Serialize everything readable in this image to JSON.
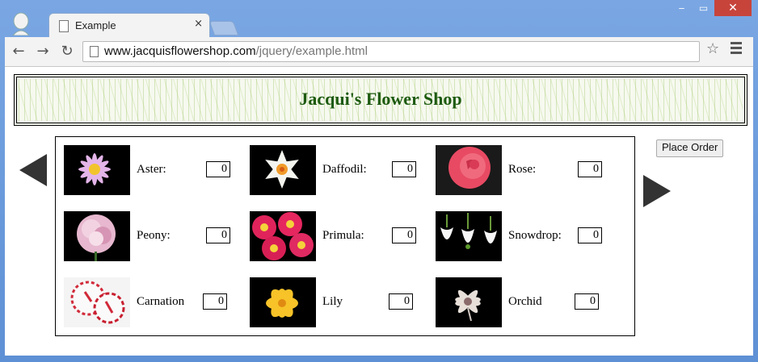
{
  "browser": {
    "tab_title": "Example",
    "tab_close": "×",
    "url_host": "www.jacquisflowershop.com",
    "url_path": "/jquery/example.html",
    "window_controls": {
      "minimize": "‒",
      "maximize": "▭",
      "close": "✕"
    },
    "nav": {
      "back": "←",
      "forward": "→",
      "reload": "↻"
    },
    "star": "☆"
  },
  "page": {
    "title": "Jacqui's Flower Shop",
    "place_order_label": "Place Order",
    "flowers": [
      {
        "name": "Aster:",
        "qty": "0"
      },
      {
        "name": "Daffodil:",
        "qty": "0"
      },
      {
        "name": "Rose:",
        "qty": "0"
      },
      {
        "name": "Peony:",
        "qty": "0"
      },
      {
        "name": "Primula:",
        "qty": "0"
      },
      {
        "name": "Snowdrop:",
        "qty": "0"
      },
      {
        "name": "Carnation",
        "qty": "0"
      },
      {
        "name": "Lily",
        "qty": "0"
      },
      {
        "name": "Orchid",
        "qty": "0"
      }
    ]
  },
  "colors": {
    "title_green": "#1d5a10",
    "window_blue": "#6b9ad8",
    "close_red": "#c7443b"
  }
}
